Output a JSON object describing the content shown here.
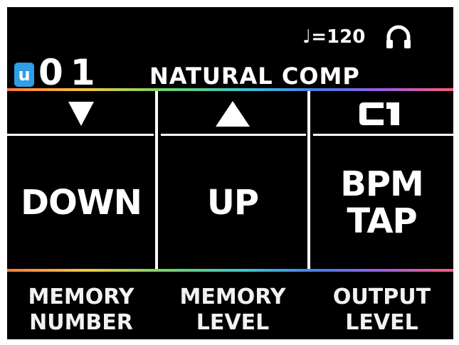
{
  "header": {
    "tempo": "♩=120",
    "headphone_icon": "headphone-icon",
    "patch_prefix": "u",
    "patch_number": "01",
    "patch_name": "NATURAL COMP"
  },
  "colors": {
    "screen_bg": "#000000",
    "text": "#ffffff",
    "badge": "#2f9ee8"
  },
  "buttons": [
    {
      "icon": "down-triangle-icon",
      "line1": "DOWN",
      "line2": ""
    },
    {
      "icon": "up-triangle-icon",
      "line1": "UP",
      "line2": ""
    },
    {
      "icon_text": "C1",
      "line1": "BPM",
      "line2": "TAP"
    }
  ],
  "knobs": [
    {
      "line1": "MEMORY",
      "line2": "NUMBER"
    },
    {
      "line1": "MEMORY",
      "line2": "LEVEL"
    },
    {
      "line1": "OUTPUT",
      "line2": "LEVEL"
    }
  ]
}
